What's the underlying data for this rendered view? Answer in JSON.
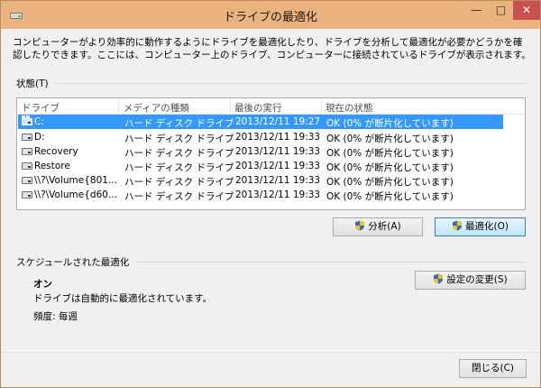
{
  "window": {
    "title": "ドライブの最適化",
    "controls": {
      "minimize": "—",
      "maximize": "□",
      "close": "✕"
    },
    "accent": "#eab27d"
  },
  "description": "コンピューターがより効率的に動作するようにドライブを最適化したり、ドライブを分析して最適化が必要かどうかを確認したりできます。ここには、コンピューター上のドライブ、コンピューターに接続されているドライブが表示されます。",
  "status": {
    "section_label": "状態(T)",
    "columns": [
      "ドライブ",
      "メディアの種類",
      "最後の実行",
      "現在の状態"
    ],
    "rows": [
      {
        "drive": "C:",
        "media": "ハード ディスク ドライブ",
        "last_run": "2013/12/11 19:27",
        "state": "OK (0% が断片化しています)",
        "selected": true,
        "icon": "system-drive-icon"
      },
      {
        "drive": "D:",
        "media": "ハード ディスク ドライブ",
        "last_run": "2013/12/11 19:33",
        "state": "OK (0% が断片化しています)",
        "selected": false,
        "icon": "drive-icon"
      },
      {
        "drive": "Recovery",
        "media": "ハード ディスク ドライブ",
        "last_run": "2013/12/11 19:33",
        "state": "OK (0% が断片化しています)",
        "selected": false,
        "icon": "drive-icon"
      },
      {
        "drive": "Restore",
        "media": "ハード ディスク ドライブ",
        "last_run": "2013/12/11 19:33",
        "state": "OK (0% が断片化しています)",
        "selected": false,
        "icon": "drive-icon"
      },
      {
        "drive": "\\\\?\\Volume{801...",
        "media": "ハード ディスク ドライブ",
        "last_run": "2013/12/11 19:33",
        "state": "OK (0% が断片化しています)",
        "selected": false,
        "icon": "drive-icon"
      },
      {
        "drive": "\\\\?\\Volume{d60...",
        "media": "ハード ディスク ドライブ",
        "last_run": "2013/12/11 19:33",
        "state": "OK (0% が断片化しています)",
        "selected": false,
        "icon": "drive-icon"
      }
    ],
    "analyze_button": "分析(A)",
    "optimize_button": "最適化(O)"
  },
  "schedule": {
    "section_label": "スケジュールされた最適化",
    "state": "オン",
    "description": "ドライブは自動的に最適化されています。",
    "frequency": "頻度: 毎週",
    "change_button": "設定の変更(S)"
  },
  "footer": {
    "close_button": "閉じる(C)"
  },
  "colors": {
    "selection": "#3399ff",
    "shield_blue": "#2b6fc9",
    "shield_yellow": "#f2c01e"
  }
}
